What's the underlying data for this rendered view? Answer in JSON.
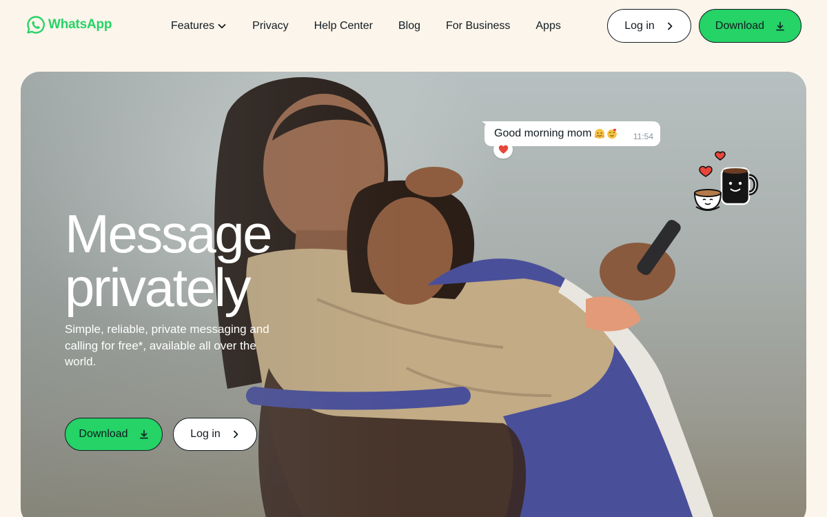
{
  "brand": {
    "name": "WhatsApp",
    "accent": "#25d366",
    "background": "#fcf5eb"
  },
  "nav": {
    "items": [
      {
        "label": "Features",
        "has_dropdown": true
      },
      {
        "label": "Privacy"
      },
      {
        "label": "Help Center"
      },
      {
        "label": "Blog"
      },
      {
        "label": "For Business"
      },
      {
        "label": "Apps"
      }
    ]
  },
  "header": {
    "login_label": "Log in",
    "download_label": "Download"
  },
  "hero": {
    "title_line1": "Message",
    "title_line2": "privately",
    "subtitle": "Simple, reliable, private messaging and calling for free*, available all over the world.",
    "download_label": "Download",
    "login_label": "Log in"
  },
  "chat": {
    "message": "Good morning mom",
    "time": "11:54",
    "reaction": "heart"
  },
  "icons": {
    "logo": "whatsapp-logo-icon",
    "dropdown": "chevron-down-icon",
    "arrow": "chevron-right-icon",
    "download": "download-icon",
    "reaction": "heart-icon",
    "sticker": "coffee-cups-sticker"
  }
}
